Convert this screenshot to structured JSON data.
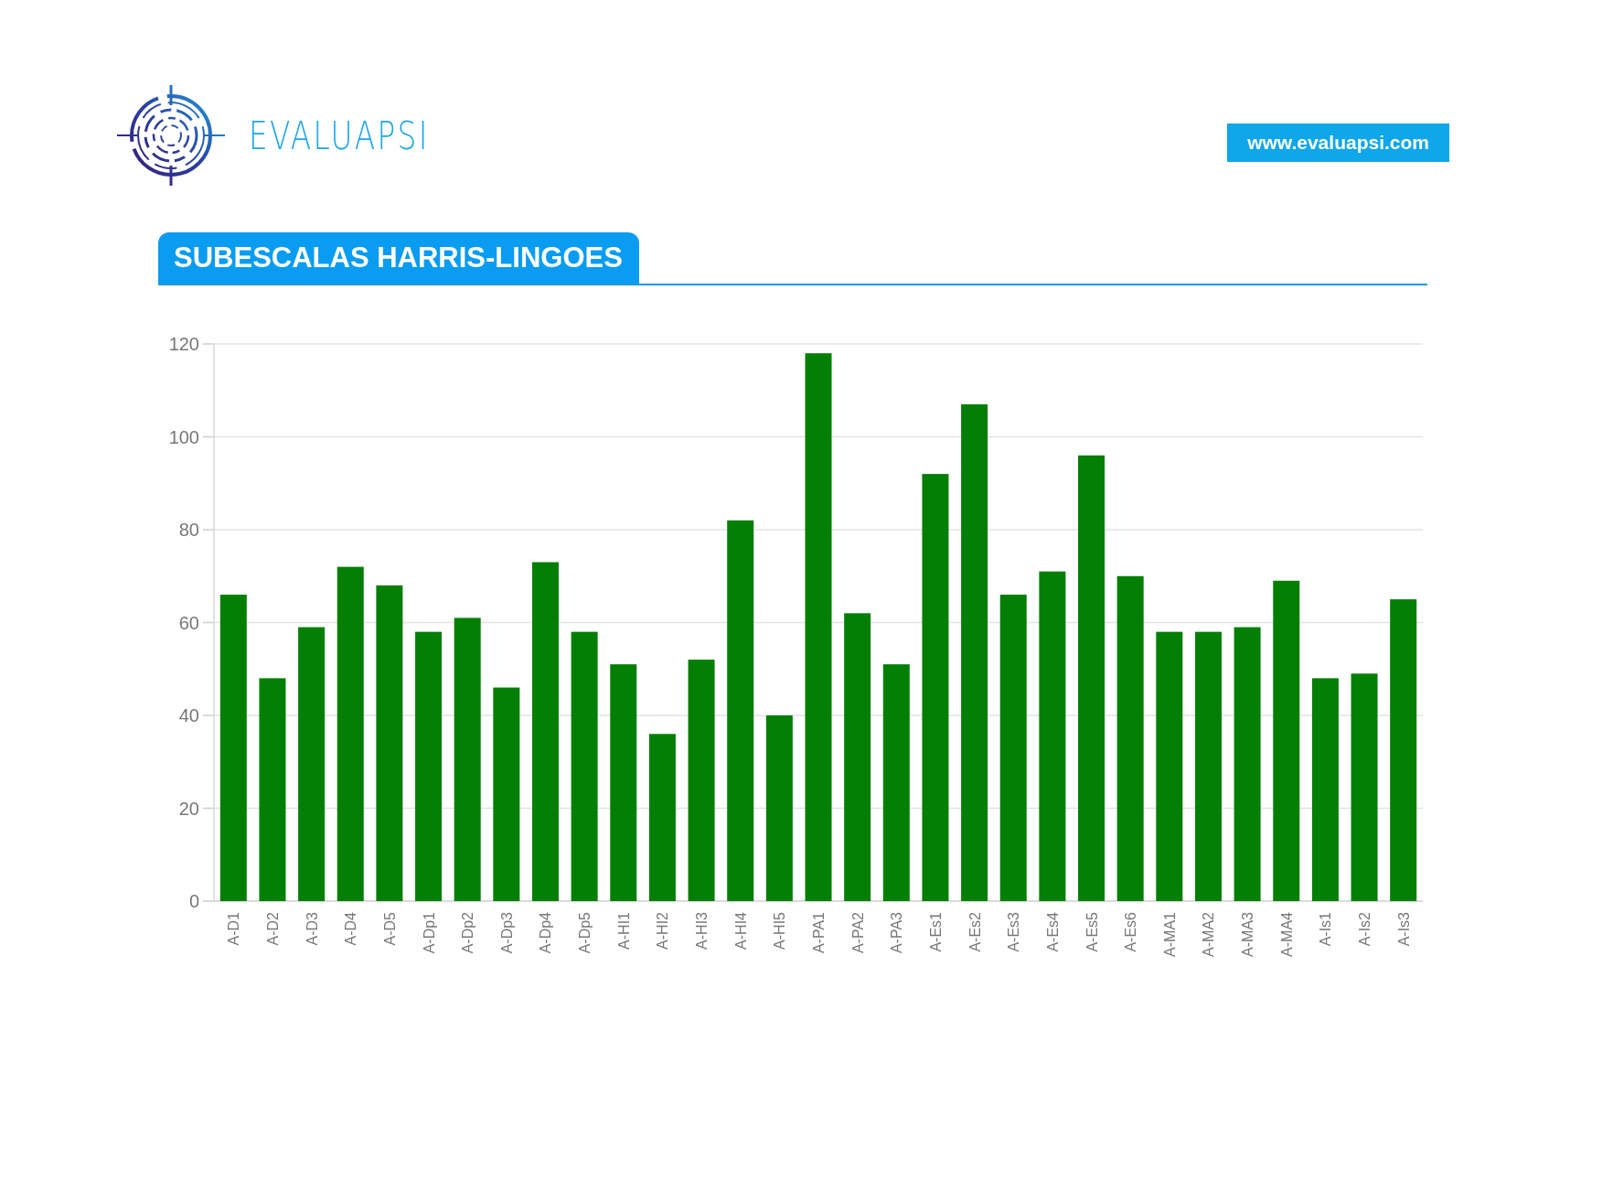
{
  "header": {
    "brand": "EVALUAPSI",
    "website": "www.evaluapsi.com"
  },
  "section": {
    "title": "SUBESCALAS HARRIS-LINGOES",
    "chart_data": {
      "type": "bar",
      "categories": [
        "A-D1",
        "A-D2",
        "A-D3",
        "A-D4",
        "A-D5",
        "A-Dp1",
        "A-Dp2",
        "A-Dp3",
        "A-Dp4",
        "A-Dp5",
        "A-HI1",
        "A-HI2",
        "A-HI3",
        "A-HI4",
        "A-HI5",
        "A-PA1",
        "A-PA2",
        "A-PA3",
        "A-Es1",
        "A-Es2",
        "A-Es3",
        "A-Es4",
        "A-Es5",
        "A-Es6",
        "A-MA1",
        "A-MA2",
        "A-MA3",
        "A-MA4",
        "A-Is1",
        "A-Is2",
        "A-Is3"
      ],
      "grid": true,
      "series": [
        {
          "color": "#027f04",
          "values": [
            66,
            48,
            59,
            72,
            68,
            58,
            61,
            46,
            73,
            58,
            51,
            36,
            52,
            82,
            40,
            118,
            62,
            51,
            92,
            107,
            66,
            71,
            96,
            70,
            58,
            58,
            59,
            69,
            48,
            49,
            65
          ]
        }
      ],
      "ylim": [
        0,
        120
      ],
      "yticks": [
        0,
        20,
        40,
        60,
        80,
        100,
        120
      ]
    }
  }
}
